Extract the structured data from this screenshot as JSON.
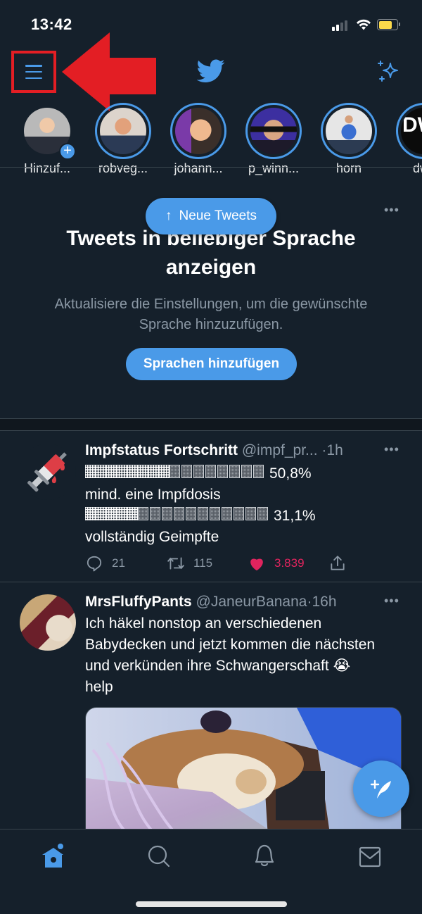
{
  "status_bar": {
    "time": "13:42",
    "signal_bars_active": 2,
    "signal_bars_total": 4,
    "battery_level": 0.75,
    "battery_color": "#fbd94b"
  },
  "header": {
    "menu_icon": "hamburger-menu-icon",
    "logo_icon": "twitter-bird-icon",
    "right_icon": "sparkle-icon",
    "annotation": "red-arrow-highlight",
    "accent_color": "#4a9ae8"
  },
  "fleets": [
    {
      "label": "Hinzuf...",
      "has_plus": true,
      "ring": false,
      "colors": [
        "#b9b9b9",
        "#f0c9a8",
        "#2a2f3a"
      ]
    },
    {
      "label": "robveg...",
      "has_plus": false,
      "ring": true,
      "colors": [
        "#dcd4cc",
        "#e2a17b",
        "#2b3a55"
      ]
    },
    {
      "label": "johann...",
      "has_plus": false,
      "ring": true,
      "colors": [
        "#7a3aa8",
        "#efb98f",
        "#3a2f2a"
      ]
    },
    {
      "label": "p_winn...",
      "has_plus": false,
      "ring": true,
      "colors": [
        "#3c2fa0",
        "#d9a683",
        "#1d1a2a"
      ]
    },
    {
      "label": "horn",
      "has_plus": false,
      "ring": true,
      "colors": [
        "#e6e6e6",
        "#3a6fd1",
        "#2c3b52"
      ]
    },
    {
      "label": "dw",
      "has_plus": false,
      "ring": true,
      "colors": [
        "#0b0b0b",
        "#ffffff",
        "#c0121e"
      ]
    }
  ],
  "language_card": {
    "title": "Tweets in beliebiger Sprache anzeigen",
    "subtitle": "Aktualisiere die Einstellungen, um die gewünschte Sprache hinzuzufügen.",
    "button_label": "Sprachen hinzufügen",
    "more": "•••"
  },
  "new_tweets_pill": {
    "arrow": "↑",
    "label": "Neue Tweets"
  },
  "tweets": [
    {
      "name": "Impfstatus Fortschritt",
      "handle": "@impf_pr...",
      "separator": "·",
      "ago": "1h",
      "more": "•••",
      "avatar_icon": "syringe-icon",
      "progress": [
        {
          "filled_blocks": 8,
          "total_blocks": 16,
          "percent_text": "50,8%",
          "value": 0.508,
          "caption": "mind. eine Impfdosis"
        },
        {
          "filled_blocks": 5,
          "total_blocks": 16,
          "percent_text": "31,1%",
          "value": 0.311,
          "caption": "vollständig Geimpfte"
        }
      ],
      "actions": {
        "replies": "21",
        "retweets": "115",
        "likes": "3.839",
        "liked": true
      }
    },
    {
      "name": "MrsFluffyPants",
      "handle": "@JaneurBanana",
      "separator": "·",
      "ago": "16h",
      "more": "•••",
      "text": "Ich häkel nonstop an verschiedenen Babydecken und jetzt kommen die nächsten und verkünden ihre Schwangerschaft",
      "emoji": "😭",
      "text_after": "help",
      "has_image": true,
      "image_description": "Dog lying on crocheted blanket next to TV"
    }
  ],
  "fab": {
    "icon": "compose-tweet-icon",
    "plus": "+"
  },
  "tabbar": {
    "tabs": [
      {
        "name": "home",
        "icon": "home-icon",
        "active": true,
        "has_dot": true
      },
      {
        "name": "search",
        "icon": "search-icon",
        "active": false
      },
      {
        "name": "notifications",
        "icon": "bell-icon",
        "active": false
      },
      {
        "name": "messages",
        "icon": "mail-icon",
        "active": false
      }
    ],
    "active_color": "#4a9ae8",
    "inactive_color": "#8b98a5"
  }
}
